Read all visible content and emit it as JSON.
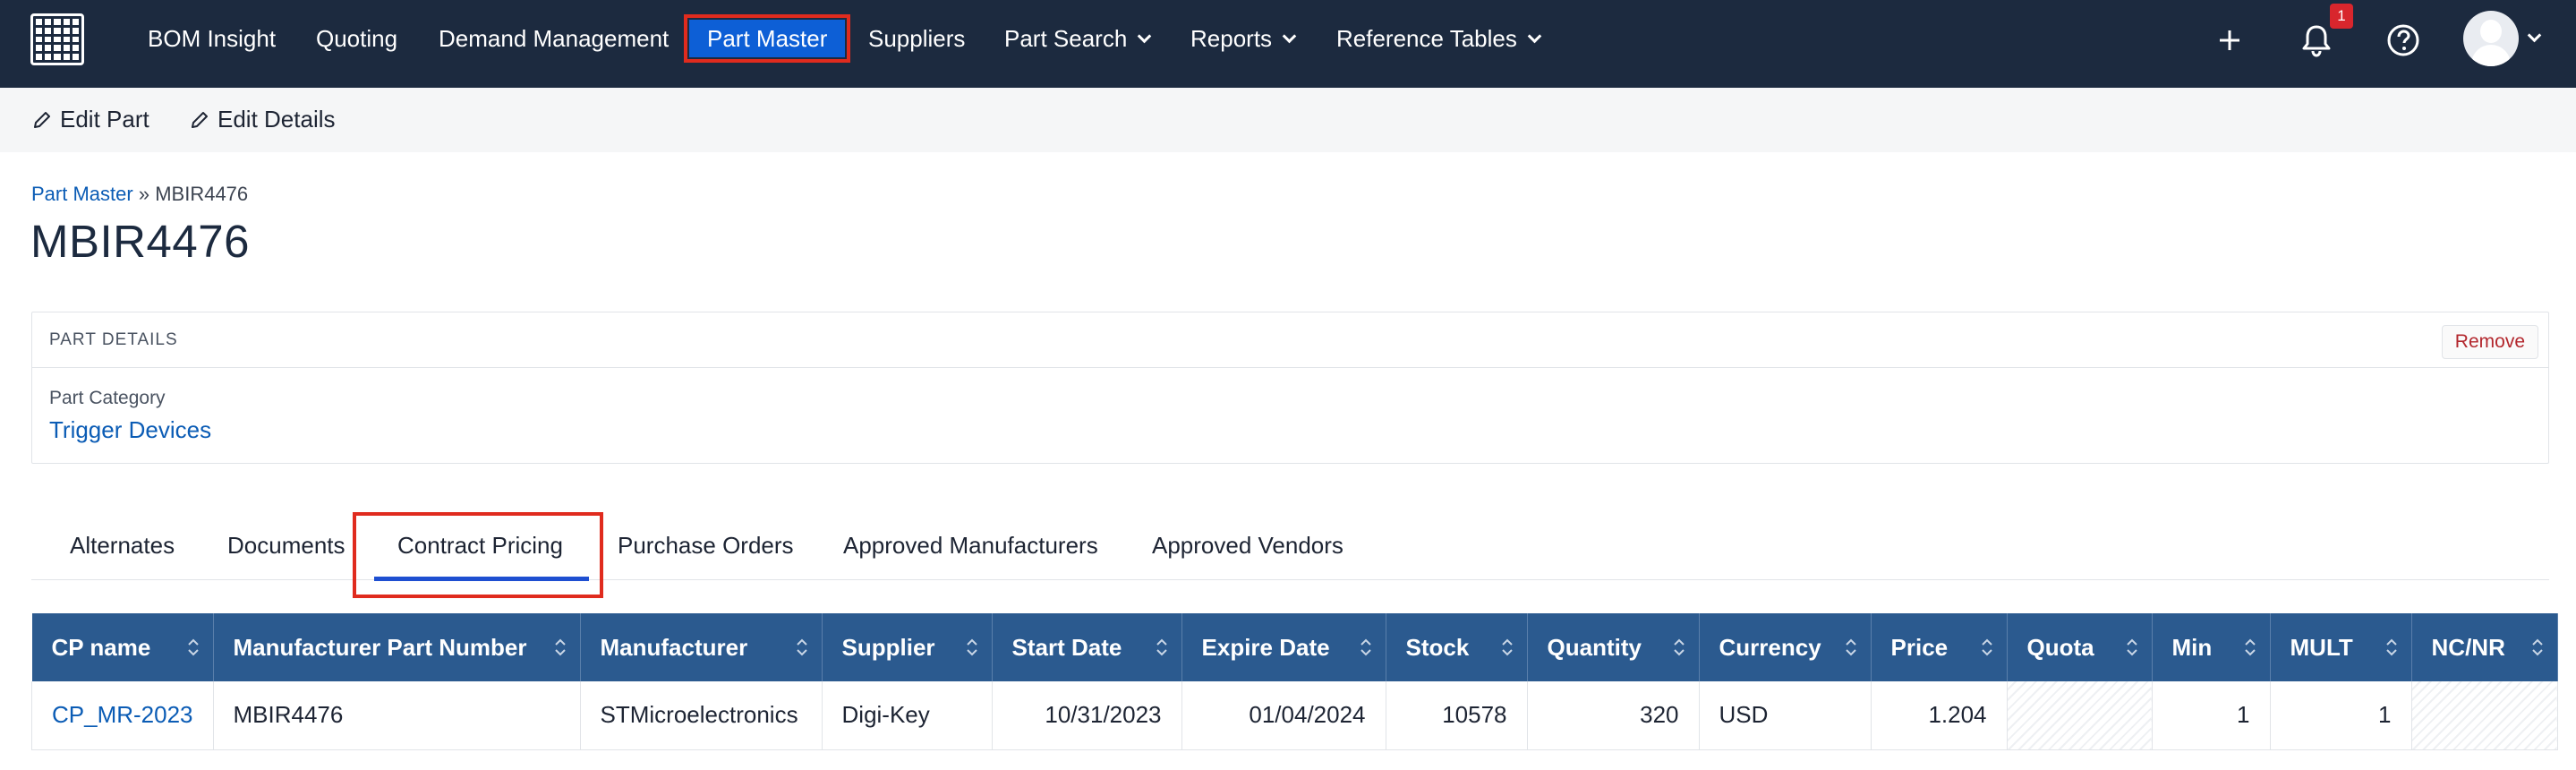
{
  "nav": {
    "items": [
      "BOM Insight",
      "Quoting",
      "Demand Management",
      "Part Master",
      "Suppliers",
      "Part Search",
      "Reports",
      "Reference Tables"
    ],
    "active": "Part Master",
    "notification_count": "1",
    "colors": {
      "navbar": "#1c2a3f",
      "active": "#0d5fd6",
      "highlight": "#e02b1e"
    }
  },
  "toolbar": {
    "edit_part": "Edit Part",
    "edit_details": "Edit Details"
  },
  "breadcrumb": {
    "root": "Part Master",
    "separator": "»",
    "current": "MBIR4476"
  },
  "page_title": "MBIR4476",
  "details": {
    "section_title": "PART DETAILS",
    "remove_label": "Remove",
    "category_label": "Part Category",
    "category_value": "Trigger Devices"
  },
  "tabs": [
    "Alternates",
    "Documents",
    "Contract Pricing",
    "Purchase Orders",
    "Approved Manufacturers",
    "Approved Vendors"
  ],
  "active_tab": "Contract Pricing",
  "table": {
    "columns": [
      "CP name",
      "Manufacturer Part Number",
      "Manufacturer",
      "Supplier",
      "Start Date",
      "Expire Date",
      "Stock",
      "Quantity",
      "Currency",
      "Price",
      "Quota",
      "Min",
      "MULT",
      "NC/NR"
    ],
    "rows": [
      [
        "CP_MR-2023",
        "MBIR4476",
        "STMicroelectronics",
        "Digi-Key",
        "10/31/2023",
        "01/04/2024",
        "10578",
        "320",
        "USD",
        "1.204",
        "",
        "1",
        "1",
        ""
      ]
    ]
  }
}
